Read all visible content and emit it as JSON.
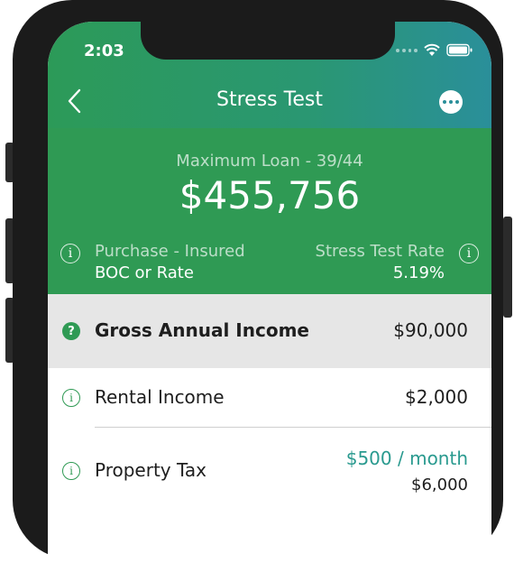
{
  "status_bar": {
    "time": "2:03"
  },
  "nav": {
    "title": "Stress Test",
    "back_icon": "chevron-left-icon",
    "more_icon": "ellipsis-icon"
  },
  "summary": {
    "max_label": "Maximum Loan - 39/44",
    "max_value": "$455,756",
    "purchase_label": "Purchase - Insured",
    "purchase_value": "BOC or Rate",
    "rate_label": "Stress Test Rate",
    "rate_value": "5.19%"
  },
  "rows": {
    "income": {
      "label": "Gross Annual Income",
      "value": "$90,000"
    },
    "rental": {
      "label": "Rental Income",
      "value": "$2,000"
    },
    "tax": {
      "label": "Property Tax",
      "monthly": "$500 / month",
      "annual": "$6,000"
    }
  },
  "colors": {
    "brand_green": "#2f9a54",
    "accent_teal": "#2a9a8f"
  }
}
